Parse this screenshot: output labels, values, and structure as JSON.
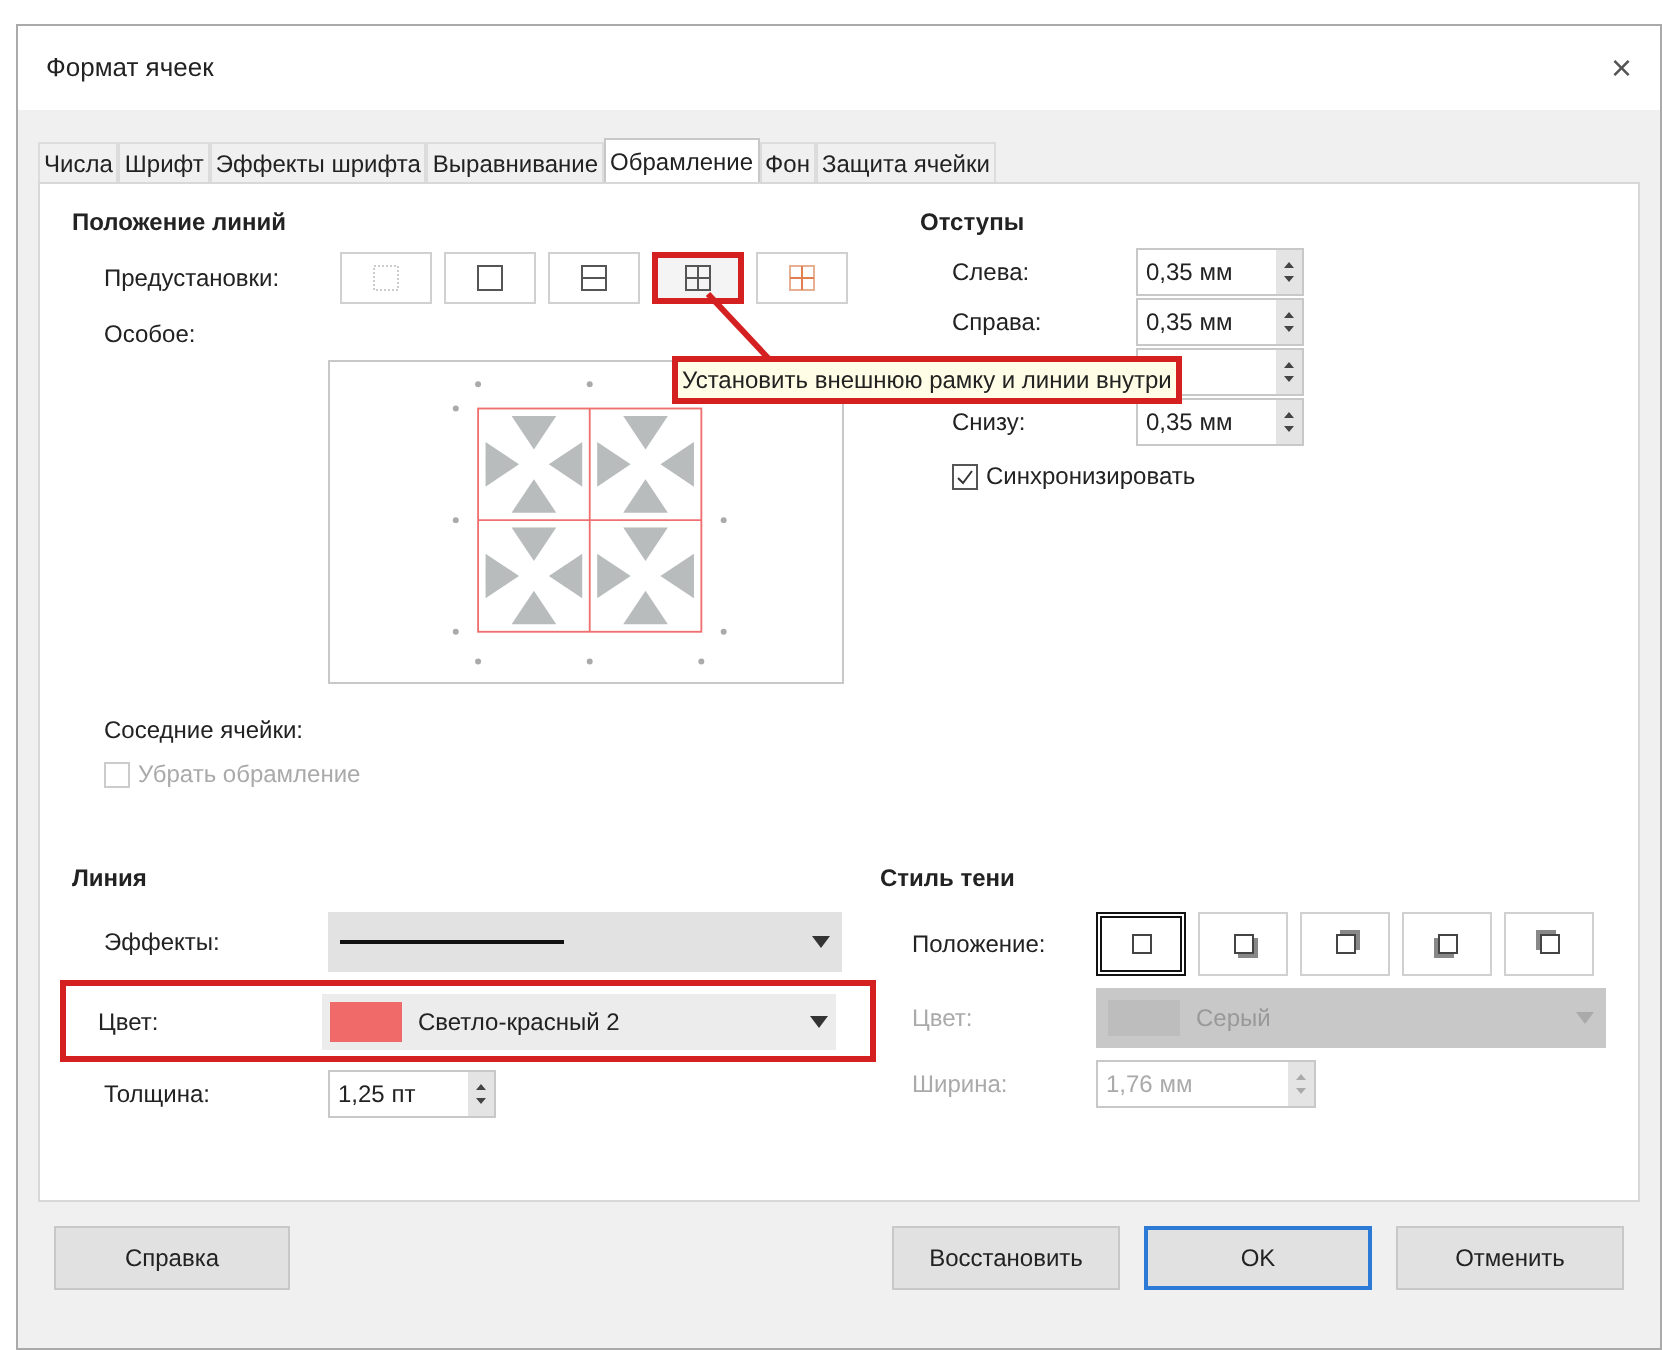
{
  "window": {
    "title": "Формат ячеек",
    "close": "×"
  },
  "tabs": [
    {
      "label": "Числа",
      "selected": false
    },
    {
      "label": "Шрифт",
      "selected": false
    },
    {
      "label": "Эффекты шрифта",
      "selected": false
    },
    {
      "label": "Выравнивание",
      "selected": false
    },
    {
      "label": "Обрамление",
      "selected": true
    },
    {
      "label": "Фон",
      "selected": false
    },
    {
      "label": "Защита ячейки",
      "selected": false
    }
  ],
  "line_arrangement": {
    "title": "Положение линий",
    "presets_label": "Предустановки:",
    "presets": [
      {
        "kind": "none",
        "highlighted": false
      },
      {
        "kind": "outer",
        "highlighted": false
      },
      {
        "kind": "outer-horizontal",
        "highlighted": false
      },
      {
        "kind": "outer-all",
        "highlighted": true
      },
      {
        "kind": "inner",
        "highlighted": false
      }
    ],
    "custom_label": "Особое:",
    "tooltip": "Установить внешнюю рамку и линии внутри"
  },
  "adjacent": {
    "title": "Соседние ячейки:",
    "remove_border": {
      "label": "Убрать обрамление",
      "checked": false,
      "disabled": true
    }
  },
  "padding": {
    "title": "Отступы",
    "rows": [
      {
        "kind": "field",
        "label": "Слева:",
        "value": "0,35 мм"
      },
      {
        "kind": "field",
        "label": "Справа:",
        "value": "0,35 мм"
      },
      {
        "kind": "covered"
      },
      {
        "kind": "field",
        "label": "Снизу:",
        "value": "0,35 мм"
      }
    ],
    "synchronize": {
      "label": "Синхронизировать",
      "checked": true
    }
  },
  "line": {
    "title": "Линия",
    "style_label": "Эффекты:",
    "color_label": "Цвет:",
    "color_field": {
      "value": "Светло-красный 2",
      "color": "#f06a6a"
    },
    "color_highlighted": true,
    "width_label": "Толщина:",
    "width": "1,25 пт"
  },
  "shadow": {
    "title": "Стиль тени",
    "position_label": "Положение:",
    "positions": [
      {
        "kind": "none",
        "selected": true
      },
      {
        "kind": "bottom-right",
        "selected": false
      },
      {
        "kind": "top-right",
        "selected": false
      },
      {
        "kind": "bottom-left",
        "selected": false
      },
      {
        "kind": "top-left",
        "selected": false
      }
    ],
    "color_label": "Цвет:",
    "color_field": {
      "value": "Серый"
    },
    "width_label": "Ширина:",
    "width": "1,76 мм",
    "disabled": true
  },
  "buttons": [
    {
      "label": "Справка",
      "kind": "help",
      "default": false
    },
    {
      "label": "Восстановить",
      "kind": "reset",
      "default": false
    },
    {
      "label": "OK",
      "kind": "ok",
      "default": true
    },
    {
      "label": "Отменить",
      "kind": "cancel",
      "default": false
    }
  ]
}
